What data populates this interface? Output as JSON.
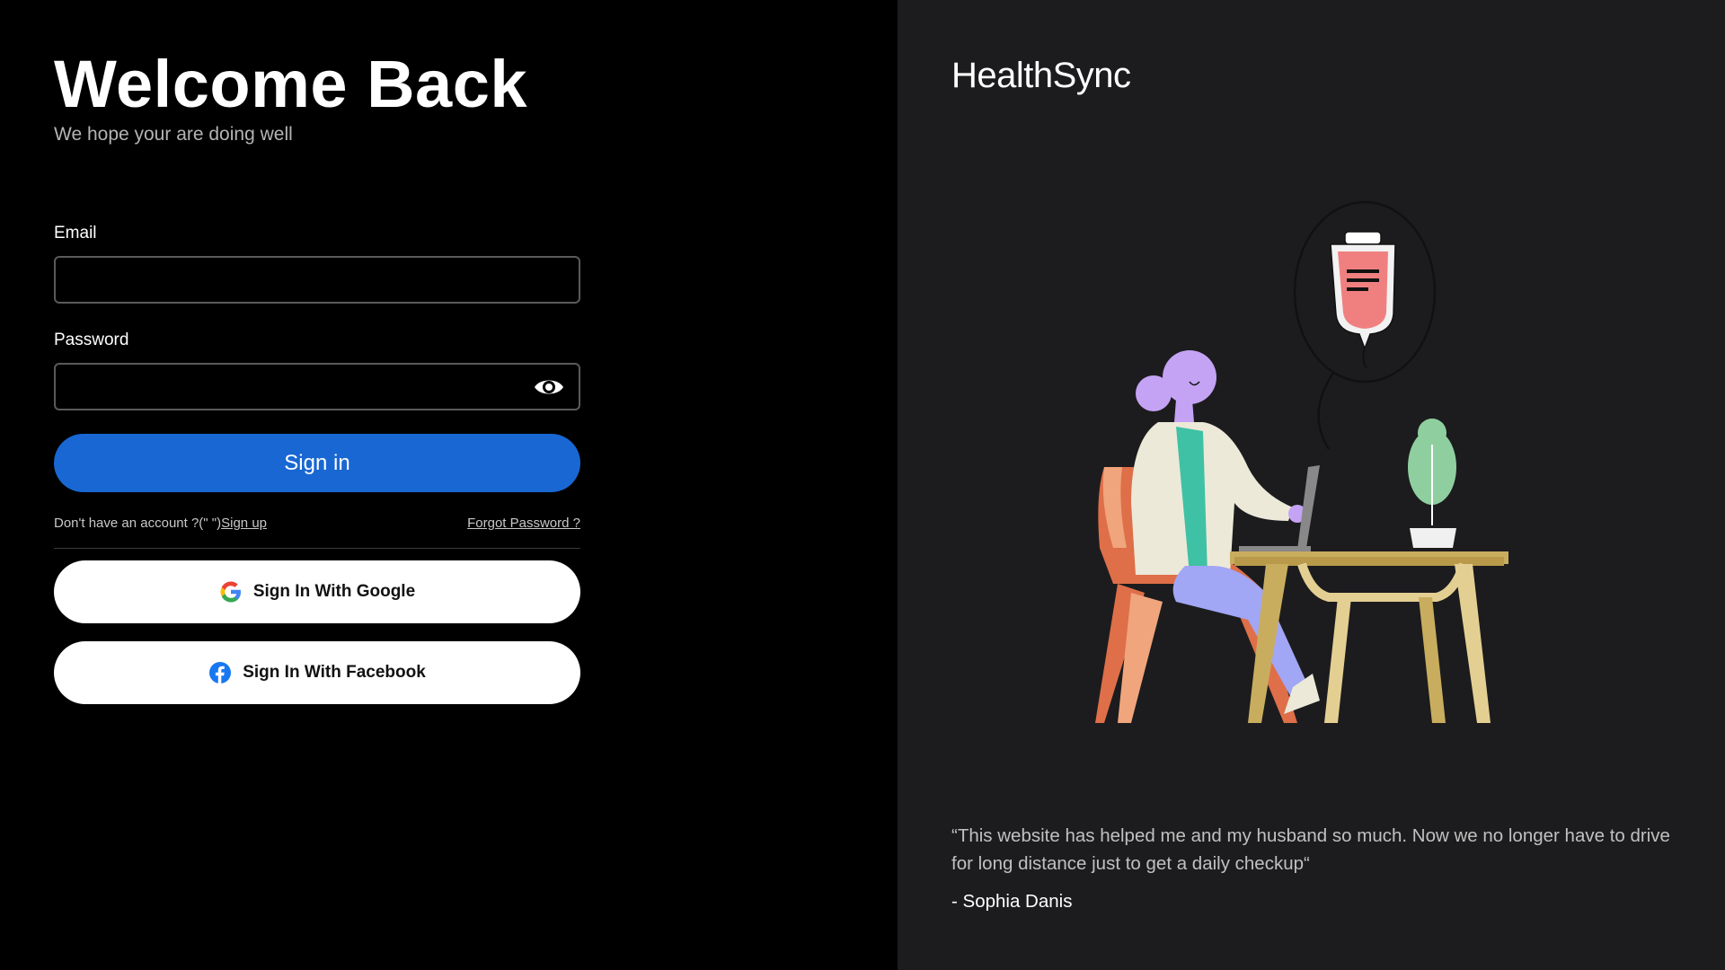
{
  "login": {
    "title": "Welcome Back",
    "subtitle": "We hope your are doing well",
    "email_label": "Email",
    "email_value": "",
    "password_label": "Password",
    "password_value": "",
    "signin_label": "Sign in",
    "no_account_text": "Don't have an account ?(\" \")",
    "signup_label": "Sign up",
    "forgot_label": "Forgot Password ?",
    "google_label": "Sign In With Google",
    "facebook_label": "Sign In With Facebook",
    "icons": {
      "password_toggle": "eye-icon",
      "google": "google-logo-icon",
      "facebook": "facebook-logo-icon"
    }
  },
  "showcase": {
    "brand": "HealthSync",
    "illustration": "doctor-at-desk-illustration",
    "quote": "“This website has helped me and my husband so much. Now we no longer have to drive for long distance just to get a daily checkup“",
    "author": "- Sophia Danis"
  },
  "colors": {
    "left_bg": "#000000",
    "right_bg": "#1c1c1e",
    "primary": "#1967d2",
    "social_button_bg": "#ffffff"
  }
}
